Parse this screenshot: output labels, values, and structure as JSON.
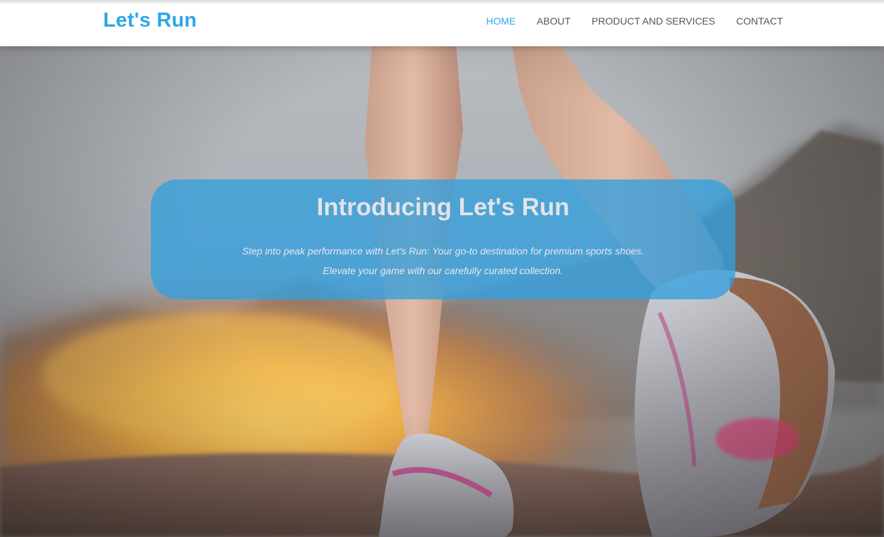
{
  "brand": {
    "name": "Let's Run"
  },
  "nav": {
    "items": [
      {
        "label": "HOME",
        "active": true
      },
      {
        "label": "ABOUT",
        "active": false
      },
      {
        "label": "PRODUCT AND SERVICES",
        "active": false
      },
      {
        "label": "CONTACT",
        "active": false
      }
    ]
  },
  "hero": {
    "title": "Introducing Let's Run",
    "lines": [
      "Step into peak performance with Let's Run: Your go-to destination for premium sports shoes.",
      "Elevate your game with our carefully curated collection."
    ]
  },
  "colors": {
    "accent": "#2ba6e8",
    "nav_text": "#555555",
    "card": "#339fde"
  },
  "icons": {
    "hero_image": "runner-feet-photo"
  }
}
